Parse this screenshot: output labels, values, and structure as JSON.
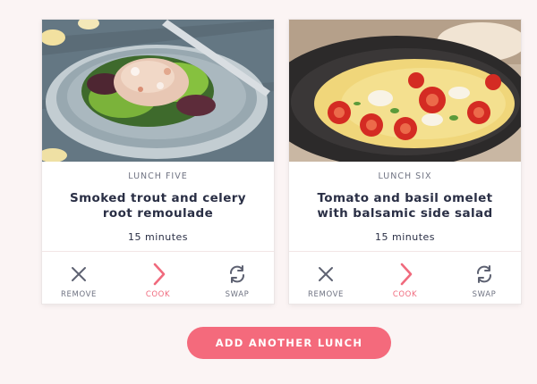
{
  "cards": [
    {
      "label": "LUNCH FIVE",
      "title": "Smoked trout and celery root remoulade",
      "time": "15 minutes",
      "photo_icon": "trout-salad-photo",
      "actions": {
        "remove": "REMOVE",
        "cook": "COOK",
        "swap": "SWAP"
      }
    },
    {
      "label": "LUNCH SIX",
      "title": "Tomato and basil omelet with balsamic side salad",
      "time": "15 minutes",
      "photo_icon": "omelet-pan-photo",
      "actions": {
        "remove": "REMOVE",
        "cook": "COOK",
        "swap": "SWAP"
      }
    }
  ],
  "add_button": {
    "label": "ADD ANOTHER LUNCH"
  },
  "colors": {
    "accent": "#f46a7c",
    "text_dark": "#2a2f45",
    "text_muted": "#6f7382",
    "background": "#fbf4f4",
    "card": "#ffffff"
  }
}
